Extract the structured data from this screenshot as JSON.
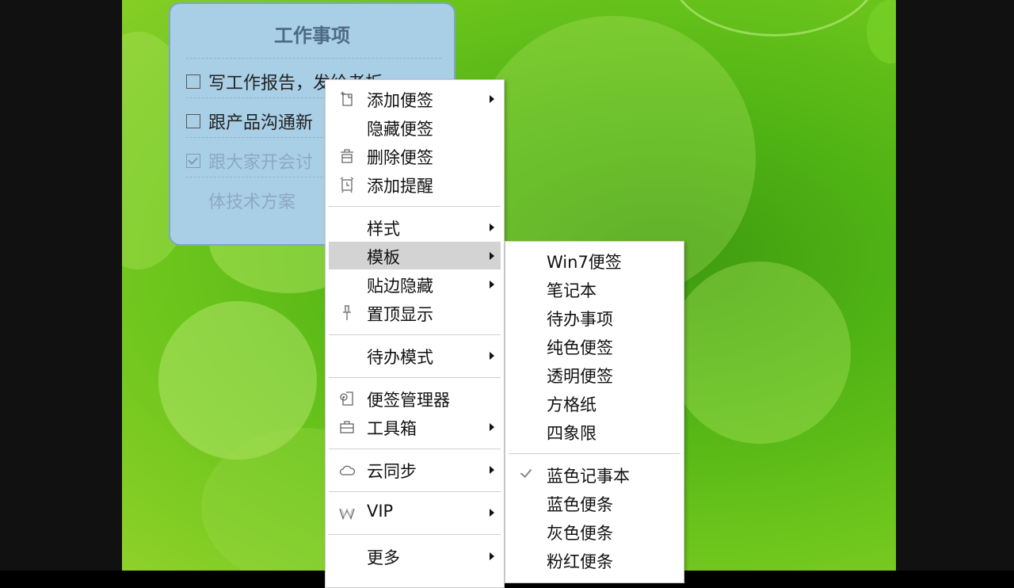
{
  "note": {
    "title": "工作事项",
    "todos": [
      {
        "text": "写工作报告，发给老板",
        "done": false
      },
      {
        "text": "跟产品沟通新",
        "done": false
      },
      {
        "text": "跟大家开会讨",
        "done": true
      },
      {
        "text": "体技术方案",
        "done": true
      }
    ]
  },
  "context_menu": {
    "items": [
      {
        "label": "添加便签",
        "icon": "add-note-icon",
        "submenu": true
      },
      {
        "label": "隐藏便签",
        "icon": "",
        "submenu": false
      },
      {
        "label": "删除便签",
        "icon": "trash-icon",
        "submenu": false
      },
      {
        "label": "添加提醒",
        "icon": "alarm-clock-icon",
        "submenu": false
      },
      {
        "label": "样式",
        "icon": "",
        "submenu": true
      },
      {
        "label": "模板",
        "icon": "",
        "submenu": true,
        "highlighted": true
      },
      {
        "label": "贴边隐藏",
        "icon": "",
        "submenu": true
      },
      {
        "label": "置顶显示",
        "icon": "pin-icon",
        "submenu": false
      },
      {
        "label": "待办模式",
        "icon": "",
        "submenu": true
      },
      {
        "label": "便签管理器",
        "icon": "gear-document-icon",
        "submenu": false
      },
      {
        "label": "工具箱",
        "icon": "toolbox-icon",
        "submenu": true
      },
      {
        "label": "云同步",
        "icon": "cloud-icon",
        "submenu": true
      },
      {
        "label": "VIP",
        "icon": "vip-crown-icon",
        "submenu": true
      },
      {
        "label": "更多",
        "icon": "",
        "submenu": true
      }
    ]
  },
  "template_submenu": {
    "items": [
      {
        "label": "Win7便签",
        "checked": false
      },
      {
        "label": "笔记本",
        "checked": false
      },
      {
        "label": "待办事项",
        "checked": false
      },
      {
        "label": "纯色便签",
        "checked": false
      },
      {
        "label": "透明便签",
        "checked": false
      },
      {
        "label": "方格纸",
        "checked": false
      },
      {
        "label": "四象限",
        "checked": false
      },
      {
        "label": "蓝色记事本",
        "checked": true
      },
      {
        "label": "蓝色便条",
        "checked": false
      },
      {
        "label": "灰色便条",
        "checked": false
      },
      {
        "label": "粉红便条",
        "checked": false
      }
    ]
  },
  "colors": {
    "note_bg": "#a9cfe6",
    "menu_highlight": "#d3d3d3",
    "wallpaper_green": "#5cb818"
  }
}
